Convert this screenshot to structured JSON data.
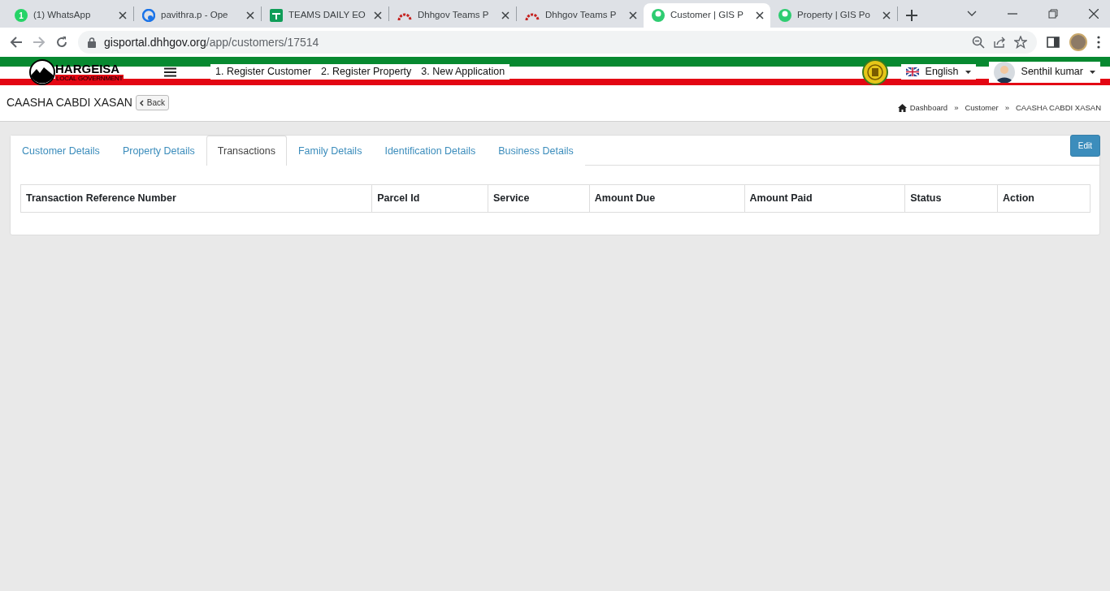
{
  "browser": {
    "tabs": [
      {
        "title": "(1) WhatsApp",
        "kind": "badge",
        "color": "#25d366",
        "badge": "1",
        "selected": false
      },
      {
        "title": "pavithra.p - Ope",
        "kind": "drop",
        "color": "#1a73e8",
        "selected": false
      },
      {
        "title": "TEAMS DAILY EO",
        "kind": "sheet",
        "color": "#0f9d58",
        "selected": false
      },
      {
        "title": "Dhhgov Teams P",
        "kind": "arc",
        "color": "#c5221f",
        "selected": false
      },
      {
        "title": "Dhhgov Teams P",
        "kind": "arc",
        "color": "#c5221f",
        "selected": false
      },
      {
        "title": "Customer | GIS P",
        "kind": "globe",
        "color": "#2ecc71",
        "selected": true
      },
      {
        "title": "Property | GIS Po",
        "kind": "globe",
        "color": "#2ecc71",
        "selected": false
      }
    ],
    "url_host": "gisportal.dhhgov.org",
    "url_path": "/app/customers/17514"
  },
  "header": {
    "logo_title": "HARGEISA",
    "logo_subtitle": "LOCAL GOVERNMENT",
    "nav": [
      "1. Register Customer",
      "2. Register Property",
      "3. New Application"
    ],
    "language": "English",
    "user": "Senthil kumar"
  },
  "page": {
    "title": "CAASHA CABDI XASAN",
    "back": "Back",
    "breadcrumb": [
      "Dashboard",
      "Customer",
      "CAASHA CABDI XASAN"
    ],
    "breadcrumb_separator": "»"
  },
  "edit_button": "Edit",
  "tabs": [
    {
      "label": "Customer Details",
      "selected": false
    },
    {
      "label": "Property Details",
      "selected": false
    },
    {
      "label": "Transactions",
      "selected": true
    },
    {
      "label": "Family Details",
      "selected": false
    },
    {
      "label": "Identification Details",
      "selected": false
    },
    {
      "label": "Business Details",
      "selected": false
    }
  ],
  "table": {
    "columns": [
      "Transaction Reference Number",
      "Parcel Id",
      "Service",
      "Amount Due",
      "Amount Paid",
      "Status",
      "Action"
    ]
  }
}
